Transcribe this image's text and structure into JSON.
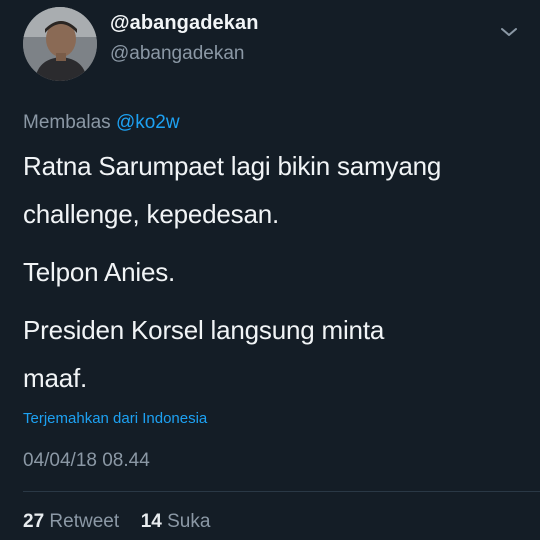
{
  "user": {
    "display_name": "@abangadekan",
    "handle": "@abangadekan",
    "avatar_icon": "profile-photo"
  },
  "reply": {
    "prefix": "Membalas",
    "mention": "@ko2w"
  },
  "tweet": {
    "paragraphs": [
      "Ratna Sarumpaet lagi bikin samyang\nchallenge, kepedesan.",
      "Telpon Anies.",
      "Presiden Korsel langsung minta\nmaaf."
    ]
  },
  "translate_label": "Terjemahkan dari Indonesia",
  "timestamp": "04/04/18 08.44",
  "stats": {
    "retweet_count": "27",
    "retweet_label": "Retweet",
    "like_count": "14",
    "like_label": "Suka"
  },
  "colors": {
    "background": "#141d26",
    "accent": "#1da1f2",
    "secondary_text": "#8b98a5"
  },
  "icons": {
    "caret": "chevron-down-icon"
  }
}
